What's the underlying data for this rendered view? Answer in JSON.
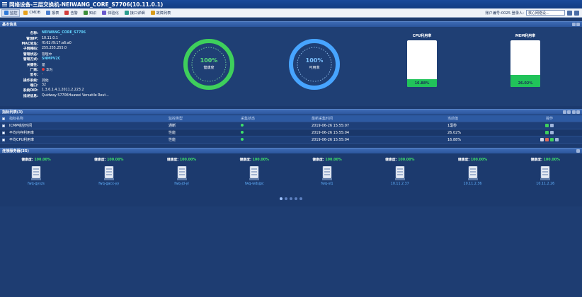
{
  "window": {
    "title": "网络设备-三层交换机-NEIWANG_CORE_S7706(10.11.0.1)"
  },
  "toolbar": {
    "items": [
      {
        "label": "监控",
        "icon": "monitor-icon",
        "color": "#2f7ad8"
      },
      {
        "label": "CMDB",
        "icon": "cmdb-icon",
        "color": "#e8a21c"
      },
      {
        "label": "报表",
        "icon": "report-icon",
        "color": "#4a7fd0"
      },
      {
        "label": "告警",
        "icon": "alarm-icon",
        "color": "#d23c3c"
      },
      {
        "label": "知识",
        "icon": "knowledge-icon",
        "color": "#3b8e3b"
      },
      {
        "label": "体验化",
        "icon": "experience-icon",
        "color": "#6a5acd"
      },
      {
        "label": "接口详细",
        "icon": "interface-icon",
        "color": "#2a9d8f"
      },
      {
        "label": "故障列表",
        "icon": "fault-icon",
        "color": "#d79b1c"
      }
    ],
    "right_text": "账户编号:0025  登录人:",
    "selected_user": "核心网络设..."
  },
  "basic_info": {
    "header": "基本信息",
    "rows": [
      {
        "key": "名称:",
        "value": "NEIWANG_CORE_S7706",
        "highlight": true
      },
      {
        "key": "管理IP:",
        "value": "10.11.0.1"
      },
      {
        "key": "MAC地址:",
        "value": "f0:62:f9:17:a6:a0"
      },
      {
        "key": "子网掩码:",
        "value": "255.255.255.0"
      },
      {
        "key": "管理状态:",
        "value": "管理中"
      },
      {
        "key": "管理方式:",
        "value": "SNMPV2C",
        "highlight": true
      },
      {
        "key": "关键性:",
        "value": "是"
      },
      {
        "key": "厂商:",
        "value": "华为",
        "vendor": true
      },
      {
        "key": "型号:",
        "value": "-"
      },
      {
        "key": "操作系统:",
        "value": "其他"
      },
      {
        "key": "端口:",
        "value": "32"
      },
      {
        "key": "系统OID:",
        "value": "1.3.6.1.4.1.2011.2.223.2"
      },
      {
        "key": "描述信息:",
        "value": "Quidway S7706Huawei Versatile Rout..."
      }
    ]
  },
  "gauges": [
    {
      "percent": "100%",
      "label": "健康度",
      "value": 1.0,
      "color": "#3ecf5c"
    },
    {
      "percent": "100%",
      "label": "可用率",
      "value": 1.0,
      "color": "#47a4ff"
    }
  ],
  "resource_bars": [
    {
      "title": "CPU利用率",
      "value": "16.88%",
      "fraction": 0.1688
    },
    {
      "title": "MEM利用率",
      "value": "26.02%",
      "fraction": 0.2602
    }
  ],
  "monitor": {
    "header": "指标列表(3)",
    "columns": [
      "指标名称",
      "监控类型",
      "采集状态",
      "最新采集时间",
      "当前值",
      "操作"
    ],
    "rows": [
      {
        "name": "ICMP响应时间",
        "type": "通断",
        "time": "2019-06-26 15:55:07",
        "value": "1毫秒"
      },
      {
        "name": "平均内存利用率",
        "type": "性能",
        "time": "2019-06-26 15:55:04",
        "value": "26.02%"
      },
      {
        "name": "平均CPU利用率",
        "type": "性能",
        "time": "2019-06-26 15:55:04",
        "value": "16.88%"
      }
    ]
  },
  "servers": {
    "header": "连接服务器(35)",
    "health_label": "健康度:",
    "items": [
      {
        "health": "100.00%",
        "name": "fwq-gyszs"
      },
      {
        "health": "100.00%",
        "name": "fwq-gacx-yy"
      },
      {
        "health": "100.00%",
        "name": "fwq-jd-yl"
      },
      {
        "health": "100.00%",
        "name": "fwq-wdsjpc"
      },
      {
        "health": "100.00%",
        "name": "fwq-sl1"
      },
      {
        "health": "100.00%",
        "name": "10.11.2.37"
      },
      {
        "health": "100.00%",
        "name": "10.11.2.36"
      },
      {
        "health": "100.00%",
        "name": "10.11.2.26"
      }
    ],
    "pages": 5,
    "current_page": 1
  }
}
